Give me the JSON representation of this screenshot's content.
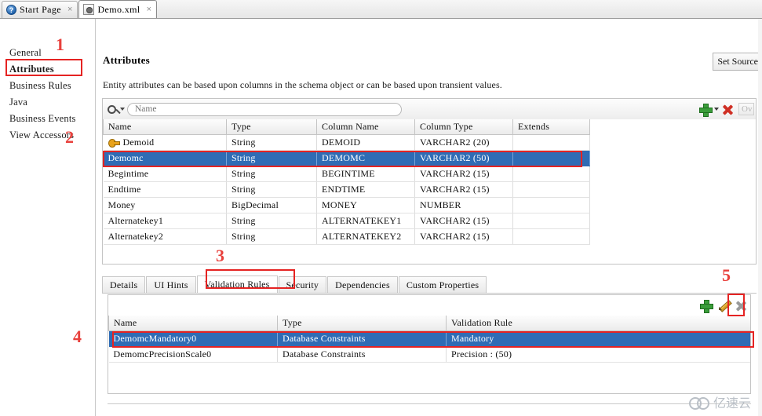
{
  "window": {
    "tabs": [
      {
        "label": "Start Page",
        "icon": "help-circle-icon",
        "close": "×",
        "active": false
      },
      {
        "label": "Demo.xml",
        "icon": "xml-file-icon",
        "close": "×",
        "active": true
      }
    ]
  },
  "sidebar": {
    "items": [
      {
        "label": "General",
        "selected": false
      },
      {
        "label": "Attributes",
        "selected": true
      },
      {
        "label": "Business Rules",
        "selected": false
      },
      {
        "label": "Java",
        "selected": false
      },
      {
        "label": "Business Events",
        "selected": false
      },
      {
        "label": "View Accessors",
        "selected": false
      }
    ]
  },
  "panel": {
    "title": "Attributes",
    "description": "Entity attributes can be based upon columns in the schema object or can be based upon transient values.",
    "set_source_label": "Set Source"
  },
  "filter": {
    "search_placeholder": "Name",
    "search_value": "",
    "icons": {
      "search": "search-icon",
      "search_caret": "chevron-down-icon",
      "add": "plus-icon",
      "add_caret": "chevron-down-icon",
      "delete": "delete-x-icon"
    },
    "overview_label": "Ov"
  },
  "attributes_table": {
    "columns": [
      "Name",
      "Type",
      "Column Name",
      "Column Type",
      "Extends"
    ],
    "rows": [
      {
        "name": "Demoid",
        "type": "String",
        "column_name": "DEMOID",
        "column_type": "VARCHAR2 (20)",
        "extends": "",
        "key": true,
        "selected": false
      },
      {
        "name": "Demomc",
        "type": "String",
        "column_name": "DEMOMC",
        "column_type": "VARCHAR2 (50)",
        "extends": "",
        "key": false,
        "selected": true
      },
      {
        "name": "Begintime",
        "type": "String",
        "column_name": "BEGINTIME",
        "column_type": "VARCHAR2 (15)",
        "extends": "",
        "key": false,
        "selected": false
      },
      {
        "name": "Endtime",
        "type": "String",
        "column_name": "ENDTIME",
        "column_type": "VARCHAR2 (15)",
        "extends": "",
        "key": false,
        "selected": false
      },
      {
        "name": "Money",
        "type": "BigDecimal",
        "column_name": "MONEY",
        "column_type": "NUMBER",
        "extends": "",
        "key": false,
        "selected": false
      },
      {
        "name": "Alternatekey1",
        "type": "String",
        "column_name": "ALTERNATEKEY1",
        "column_type": "VARCHAR2 (15)",
        "extends": "",
        "key": false,
        "selected": false
      },
      {
        "name": "Alternatekey2",
        "type": "String",
        "column_name": "ALTERNATEKEY2",
        "column_type": "VARCHAR2 (15)",
        "extends": "",
        "key": false,
        "selected": false
      }
    ]
  },
  "detail_tabs": [
    {
      "label": "Details",
      "active": false
    },
    {
      "label": "UI Hints",
      "active": false
    },
    {
      "label": "Validation Rules",
      "active": true
    },
    {
      "label": "Security",
      "active": false
    },
    {
      "label": "Dependencies",
      "active": false
    },
    {
      "label": "Custom Properties",
      "active": false
    }
  ],
  "validation_toolbar": {
    "icons": {
      "add": "plus-icon",
      "edit": "pencil-icon",
      "delete": "delete-x-icon"
    }
  },
  "validation_table": {
    "columns": [
      "Name",
      "Type",
      "Validation Rule"
    ],
    "rows": [
      {
        "name": "DemomcMandatory0",
        "type": "Database Constraints",
        "rule": "Mandatory",
        "selected": true
      },
      {
        "name": "DemomcPrecisionScale0",
        "type": "Database Constraints",
        "rule": "Precision : (50)",
        "selected": false
      }
    ]
  },
  "annotations": {
    "numbers": [
      "1",
      "2",
      "3",
      "4",
      "5"
    ],
    "color": "#e8403c"
  },
  "watermark": {
    "text": "亿速云",
    "icon": "cloud-icon"
  }
}
